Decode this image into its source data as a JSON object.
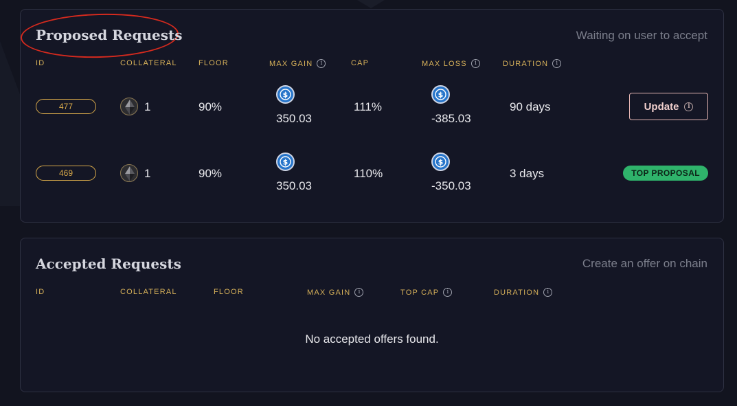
{
  "proposed": {
    "title": "Proposed Requests",
    "subtitle": "Waiting on user to accept",
    "columns": {
      "id": "ID",
      "collateral": "COLLATERAL",
      "floor": "FLOOR",
      "max_gain": "MAX GAIN",
      "cap": "CAP",
      "max_loss": "MAX LOSS",
      "duration": "DURATION"
    },
    "rows": [
      {
        "id": "477",
        "collateral": "1",
        "floor": "90%",
        "max_gain": "350.03",
        "cap": "111%",
        "max_loss": "-385.03",
        "duration": "90 days",
        "action_label": "Update"
      },
      {
        "id": "469",
        "collateral": "1",
        "floor": "90%",
        "max_gain": "350.03",
        "cap": "110%",
        "max_loss": "-350.03",
        "duration": "3 days",
        "badge_label": "TOP PROPOSAL"
      }
    ]
  },
  "accepted": {
    "title": "Accepted Requests",
    "subtitle": "Create an offer on chain",
    "columns": {
      "id": "ID",
      "collateral": "COLLATERAL",
      "floor": "FLOOR",
      "max_gain": "MAX GAIN",
      "top_cap": "TOP CAP",
      "duration": "DURATION"
    },
    "empty_message": "No accepted offers found."
  },
  "icons": {
    "info": "info-icon",
    "collateral": "eth-icon",
    "currency": "usdc-icon"
  },
  "colors": {
    "accent_gold": "#d8b25a",
    "top_proposal_green": "#2fb36b",
    "usdc_blue": "#2775ca",
    "highlight_ring": "#d62a1e"
  }
}
